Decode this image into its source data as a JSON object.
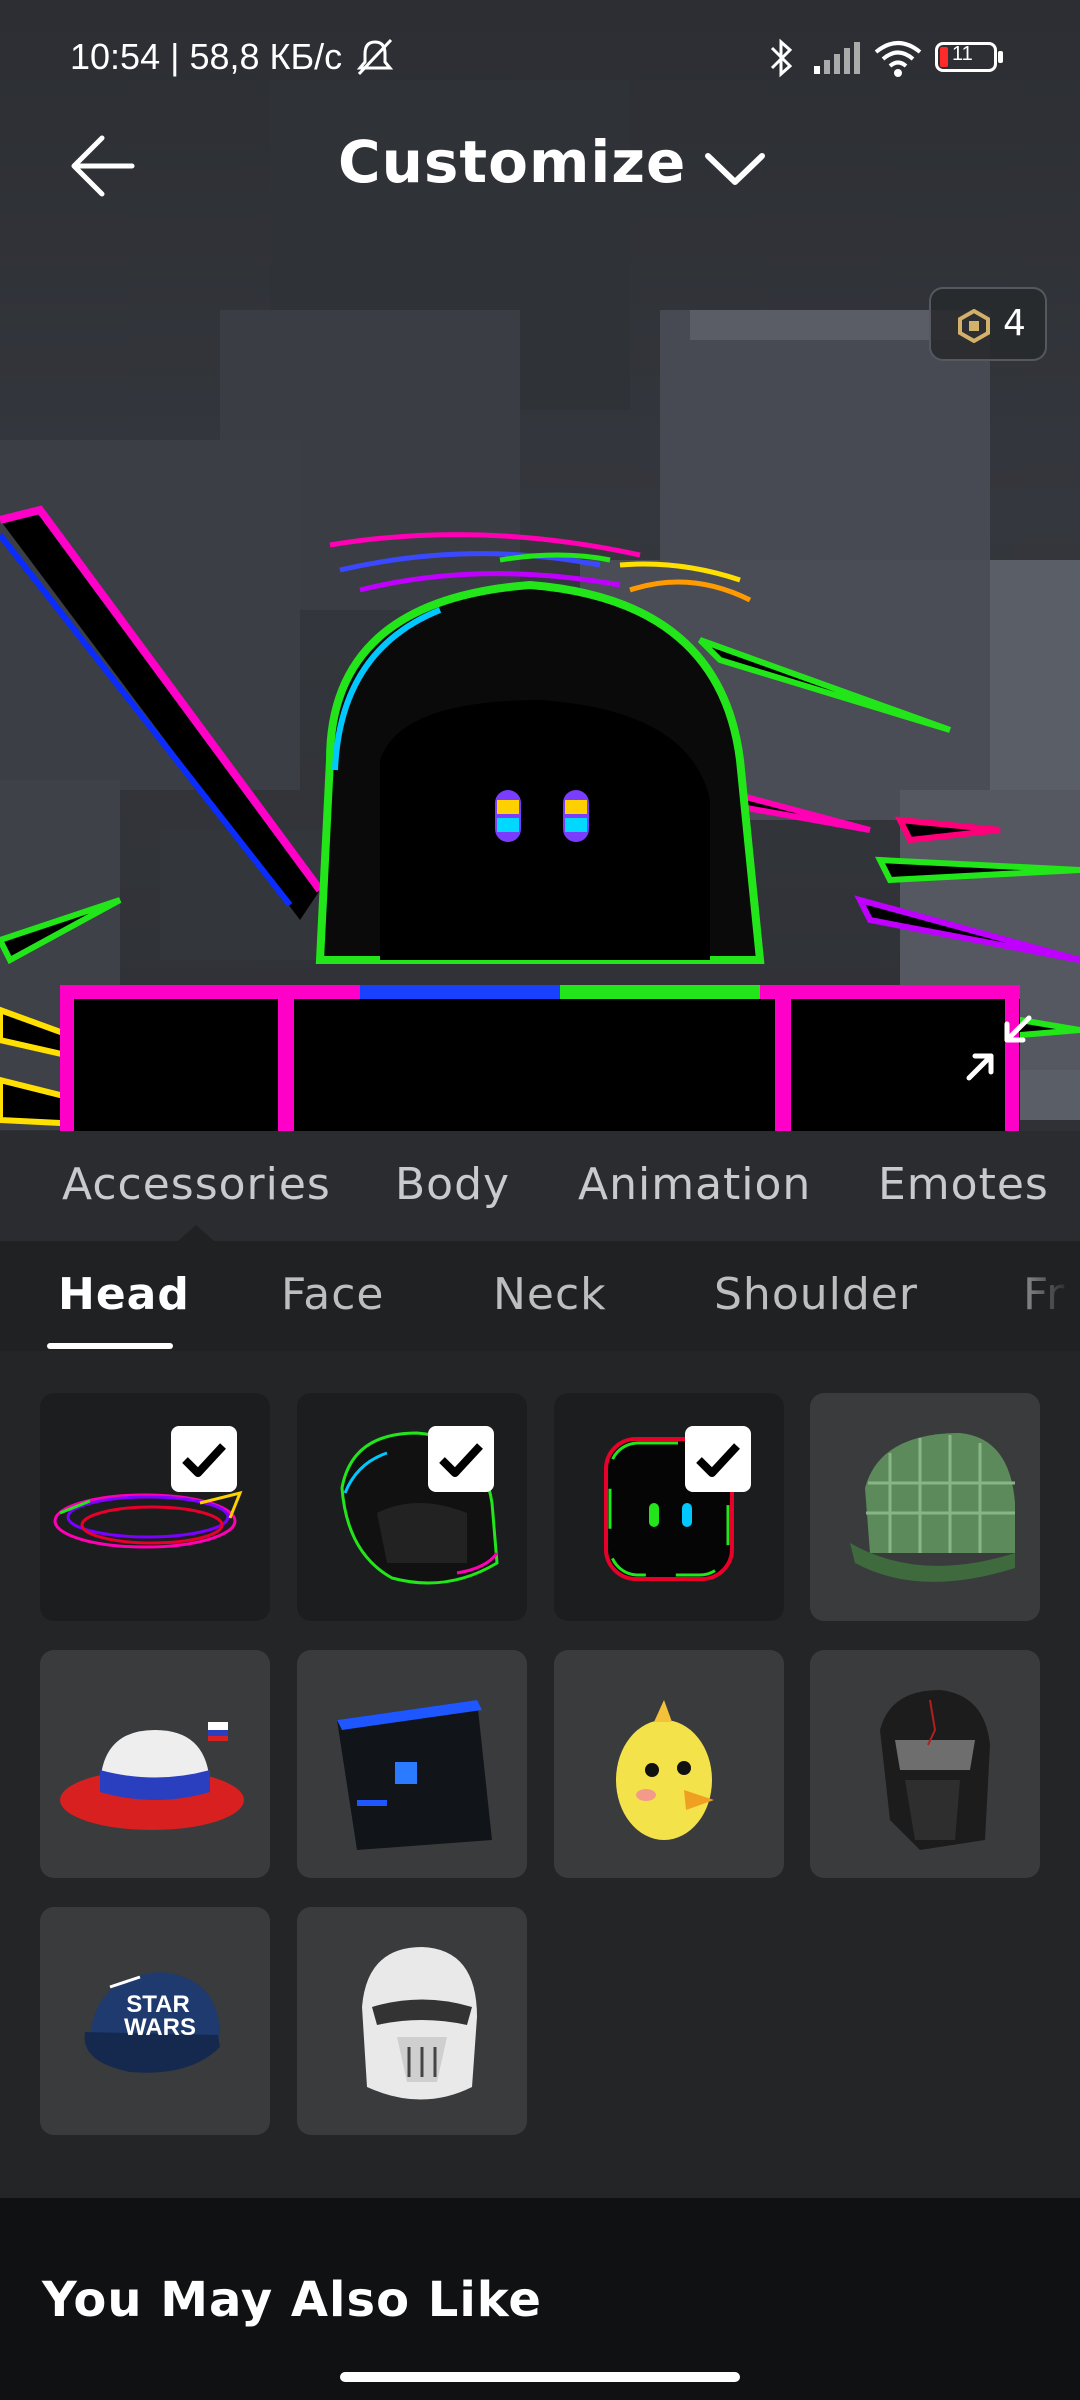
{
  "status_bar": {
    "time": "10:54 | 58,8 КБ/с",
    "battery": "11"
  },
  "header": {
    "title": "Customize"
  },
  "currency": {
    "amount": "4"
  },
  "category_tabs": [
    {
      "label": "Accessories",
      "active": true
    },
    {
      "label": "Body",
      "active": false
    },
    {
      "label": "Animation",
      "active": false
    },
    {
      "label": "Emotes",
      "active": false
    }
  ],
  "sub_tabs": [
    {
      "label": "Head",
      "active": true
    },
    {
      "label": "Face",
      "active": false
    },
    {
      "label": "Neck",
      "active": false
    },
    {
      "label": "Shoulder",
      "active": false
    },
    {
      "label": "Fr",
      "active": false
    }
  ],
  "items": [
    {
      "icon": "neon-halo-icon",
      "equipped": true
    },
    {
      "icon": "neon-hood-icon",
      "equipped": true
    },
    {
      "icon": "neon-face-icon",
      "equipped": true
    },
    {
      "icon": "plaid-cap-icon",
      "equipped": false
    },
    {
      "icon": "fedora-hat-icon",
      "equipped": false
    },
    {
      "icon": "dark-cube-icon",
      "equipped": false
    },
    {
      "icon": "chick-head-icon",
      "equipped": false
    },
    {
      "icon": "dark-helmet-icon",
      "equipped": false
    },
    {
      "icon": "star-wars-cap-icon",
      "equipped": false
    },
    {
      "icon": "trooper-helmet-icon",
      "equipped": false
    }
  ],
  "item_cap_text": [
    "STAR",
    "WARS"
  ],
  "recommendations": {
    "title": "You May Also Like"
  },
  "colors": {
    "background": "#232527",
    "tile": "#393b3d",
    "tile_equipped": "#1c1d1f",
    "accent_white": "#ffffff"
  }
}
